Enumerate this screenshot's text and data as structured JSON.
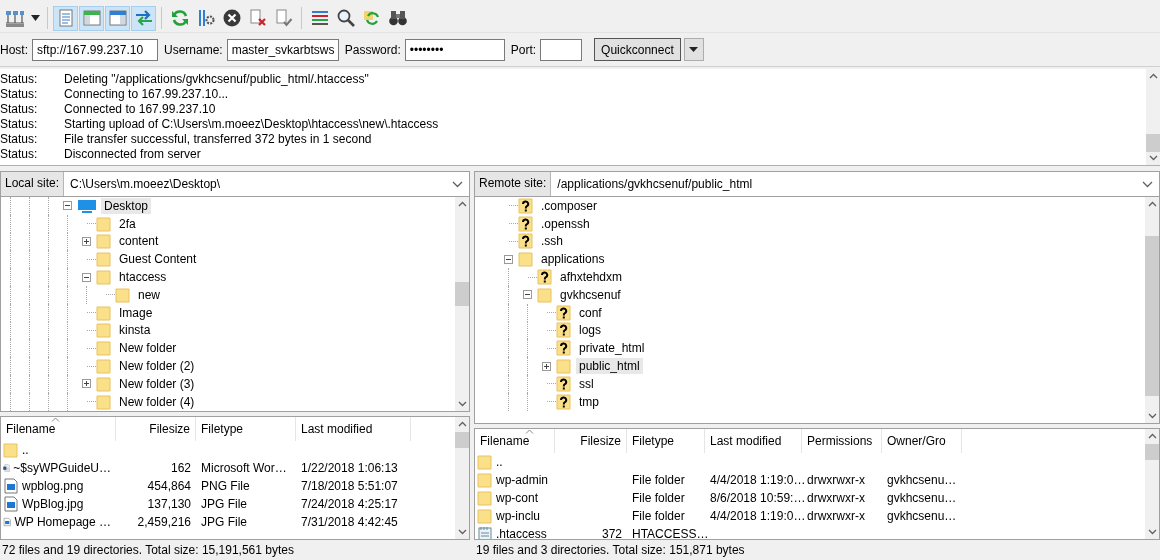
{
  "toolbar": {
    "groups": [
      [
        {
          "kind": "site-manager",
          "pressed": false
        },
        {
          "kind": "dropdown",
          "pressed": false
        }
      ],
      [
        {
          "kind": "log",
          "pressed": true
        },
        {
          "kind": "tree-local",
          "pressed": true
        },
        {
          "kind": "tree-remote",
          "pressed": true
        },
        {
          "kind": "queue",
          "pressed": true
        }
      ],
      [
        {
          "kind": "refresh",
          "pressed": false
        },
        {
          "kind": "process",
          "pressed": false
        },
        {
          "kind": "cancel",
          "pressed": false
        },
        {
          "kind": "disconnect",
          "pressed": false
        },
        {
          "kind": "reconnect",
          "pressed": false
        }
      ],
      [
        {
          "kind": "filter",
          "pressed": false
        },
        {
          "kind": "compare",
          "pressed": false
        },
        {
          "kind": "sync",
          "pressed": false
        },
        {
          "kind": "search",
          "pressed": false
        }
      ]
    ]
  },
  "quickconnect": {
    "host": {
      "label": "Host:",
      "value": "sftp://167.99.237.10"
    },
    "username": {
      "label": "Username:",
      "value": "master_svkarbtsws"
    },
    "password": {
      "label": "Password:",
      "value": "••••••••"
    },
    "port": {
      "label": "Port:"
    },
    "button": "Quickconnect"
  },
  "log": {
    "entries": [
      {
        "label": "Status:",
        "message": "Deleting \"/applications/gvkhcsenuf/public_html/.htaccess\""
      },
      {
        "label": "Status:",
        "message": "Connecting to 167.99.237.10..."
      },
      {
        "label": "Status:",
        "message": "Connected to 167.99.237.10"
      },
      {
        "label": "Status:",
        "message": "Starting upload of C:\\Users\\m.moeez\\Desktop\\htaccess\\new\\.htaccess"
      },
      {
        "label": "Status:",
        "message": "File transfer successful, transferred 372 bytes in 1 second"
      },
      {
        "label": "Status:",
        "message": "Disconnected from server"
      }
    ]
  },
  "local": {
    "site_label": "Local site:",
    "path": "C:\\Users\\m.moeez\\Desktop\\",
    "tree": [
      {
        "name": "Desktop",
        "kind": "desktop",
        "expanded": true,
        "selected": true,
        "children": [
          {
            "name": "2fa",
            "kind": "folder",
            "selected": false
          },
          {
            "name": "content",
            "kind": "folder",
            "expanded": false,
            "selected": false
          },
          {
            "name": "Guest Content",
            "kind": "folder",
            "selected": false
          },
          {
            "name": "htaccess",
            "kind": "folder",
            "expanded": true,
            "selected": false,
            "children": [
              {
                "name": "new",
                "kind": "folder",
                "selected": false
              }
            ]
          },
          {
            "name": "Image",
            "kind": "folder",
            "selected": false
          },
          {
            "name": "kinsta",
            "kind": "folder",
            "selected": false
          },
          {
            "name": "New folder",
            "kind": "folder",
            "selected": false
          },
          {
            "name": "New folder (2)",
            "kind": "folder",
            "selected": false
          },
          {
            "name": "New folder (3)",
            "kind": "folder",
            "expanded": false,
            "selected": false
          },
          {
            "name": "New folder (4)",
            "kind": "folder",
            "selected": false
          }
        ]
      }
    ],
    "columns": [
      {
        "label": "Filename",
        "sorted": true
      },
      {
        "label": "Filesize",
        "sorted": false
      },
      {
        "label": "Filetype",
        "sorted": false
      },
      {
        "label": "Last modified",
        "sorted": false
      }
    ],
    "rows": [
      {
        "kind": "folder",
        "name": ".."
      },
      {
        "kind": "word",
        "name": "~$syWPGuideU…",
        "size": "162",
        "type": "Microsoft Wor…",
        "modified": "1/22/2018 1:06:13"
      },
      {
        "kind": "image",
        "name": "wpblog.png",
        "size": "454,864",
        "type": "PNG File",
        "modified": "7/18/2018 5:51:07"
      },
      {
        "kind": "image",
        "name": "WpBlog.jpg",
        "size": "137,130",
        "type": "JPG File",
        "modified": "7/24/2018 4:25:17"
      },
      {
        "kind": "image",
        "name": "WP Homepage …",
        "size": "2,459,216",
        "type": "JPG File",
        "modified": "7/31/2018 4:42:45"
      }
    ],
    "status": "72 files and 19 directories. Total size: 15,191,561 bytes"
  },
  "remote": {
    "site_label": "Remote site:",
    "path": "/applications/gvkhcsenuf/public_html",
    "tree": [
      {
        "name": ".composer",
        "kind": "unknown",
        "selected": false
      },
      {
        "name": ".openssh",
        "kind": "unknown",
        "selected": false
      },
      {
        "name": ".ssh",
        "kind": "unknown",
        "selected": false
      },
      {
        "name": "applications",
        "kind": "folder",
        "expanded": true,
        "selected": false,
        "children": [
          {
            "name": "afhxtehdxm",
            "kind": "unknown",
            "selected": false
          },
          {
            "name": "gvkhcsenuf",
            "kind": "folder",
            "expanded": true,
            "selected": false,
            "children": [
              {
                "name": "conf",
                "kind": "unknown",
                "selected": false
              },
              {
                "name": "logs",
                "kind": "unknown",
                "selected": false
              },
              {
                "name": "private_html",
                "kind": "unknown",
                "selected": false
              },
              {
                "name": "public_html",
                "kind": "folder",
                "expanded": false,
                "selected": true
              },
              {
                "name": "ssl",
                "kind": "unknown",
                "selected": false
              },
              {
                "name": "tmp",
                "kind": "unknown",
                "selected": false
              }
            ]
          }
        ]
      }
    ],
    "columns": [
      {
        "label": "Filename",
        "sorted": true
      },
      {
        "label": "Filesize",
        "sorted": false
      },
      {
        "label": "Filetype",
        "sorted": false
      },
      {
        "label": "Last modified",
        "sorted": false
      },
      {
        "label": "Permissions",
        "sorted": false
      },
      {
        "label": "Owner/Gro",
        "sorted": false
      }
    ],
    "rows": [
      {
        "kind": "folder",
        "name": ".."
      },
      {
        "kind": "folder",
        "name": "wp-admin",
        "type": "File folder",
        "modified": "4/4/2018 1:19:0…",
        "permissions": "drwxrwxr-x",
        "owner": "gvkhcsenu…"
      },
      {
        "kind": "folder",
        "name": "wp-cont",
        "type": "File folder",
        "modified": "8/6/2018 10:59:…",
        "permissions": "drwxrwxr-x",
        "owner": "gvkhcsenu…"
      },
      {
        "kind": "folder",
        "name": "wp-inclu",
        "type": "File folder",
        "modified": "4/4/2018 1:19:0…",
        "permissions": "drwxrwxr-x",
        "owner": "gvkhcsenu…"
      },
      {
        "kind": "text",
        "name": ".htaccess",
        "size": "372",
        "type": "HTACCESS…"
      }
    ],
    "status": "19 files and 3 directories. Total size: 151,871 bytes"
  }
}
